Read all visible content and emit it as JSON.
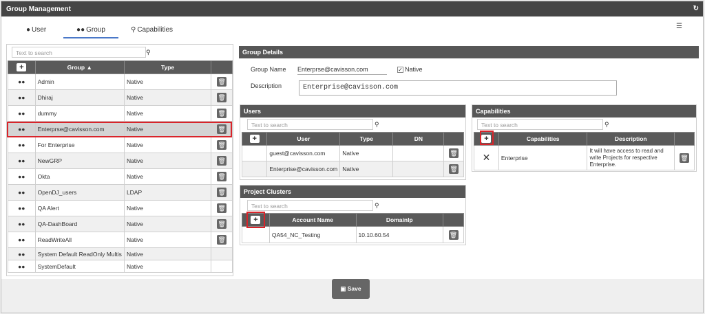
{
  "app": {
    "title": "Group Management"
  },
  "tabs": [
    {
      "label": "User",
      "icon": "user-icon"
    },
    {
      "label": "Group",
      "icon": "group-icon"
    },
    {
      "label": "Capabilities",
      "icon": "capabilities-icon"
    }
  ],
  "groupList": {
    "search_placeholder": "Text to search",
    "col_group": "Group ▲",
    "col_type": "Type",
    "rows": [
      {
        "name": "Admin",
        "type": "Native"
      },
      {
        "name": "Dhiraj",
        "type": "Native"
      },
      {
        "name": "dummy",
        "type": "Native"
      },
      {
        "name": "Enterprse@cavisson.com",
        "type": "Native"
      },
      {
        "name": "For Enterprise",
        "type": "Native"
      },
      {
        "name": "NewGRP",
        "type": "Native"
      },
      {
        "name": "Okta",
        "type": "Native"
      },
      {
        "name": "OpenDJ_users",
        "type": "LDAP"
      },
      {
        "name": "QA Alert",
        "type": "Native"
      },
      {
        "name": "QA-DashBoard",
        "type": "Native"
      },
      {
        "name": "ReadWriteAll",
        "type": "Native"
      },
      {
        "name": "System Default ReadOnly Multis",
        "type": "Native"
      },
      {
        "name": "SystemDefault",
        "type": "Native"
      }
    ]
  },
  "details": {
    "header": "Group Details",
    "name_label": "Group Name",
    "name_value": "Enterprse@cavisson.com",
    "native_label": "Native",
    "desc_label": "Description",
    "desc_value": "Enterprise@cavisson.com"
  },
  "users": {
    "header": "Users",
    "search_placeholder": "Text to search",
    "col_user": "User",
    "col_type": "Type",
    "col_dn": "DN",
    "rows": [
      {
        "user": "guest@cavisson.com",
        "type": "Native",
        "dn": ""
      },
      {
        "user": "Enterprise@cavisson.com",
        "type": "Native",
        "dn": ""
      }
    ]
  },
  "capabilities": {
    "header": "Capabilities",
    "search_placeholder": "Text to search",
    "col_cap": "Capabilities",
    "col_desc": "Description",
    "rows": [
      {
        "name": "Enterprise",
        "desc": "It will have access to read and write Projects for respective Enterprise."
      }
    ]
  },
  "clusters": {
    "header": "Project Clusters",
    "search_placeholder": "Text to search",
    "col_account": "Account Name",
    "col_domain": "DomainIp",
    "rows": [
      {
        "account": "QA54_NC_Testing",
        "domain": "10.10.60.54"
      }
    ]
  },
  "save_label": "Save"
}
